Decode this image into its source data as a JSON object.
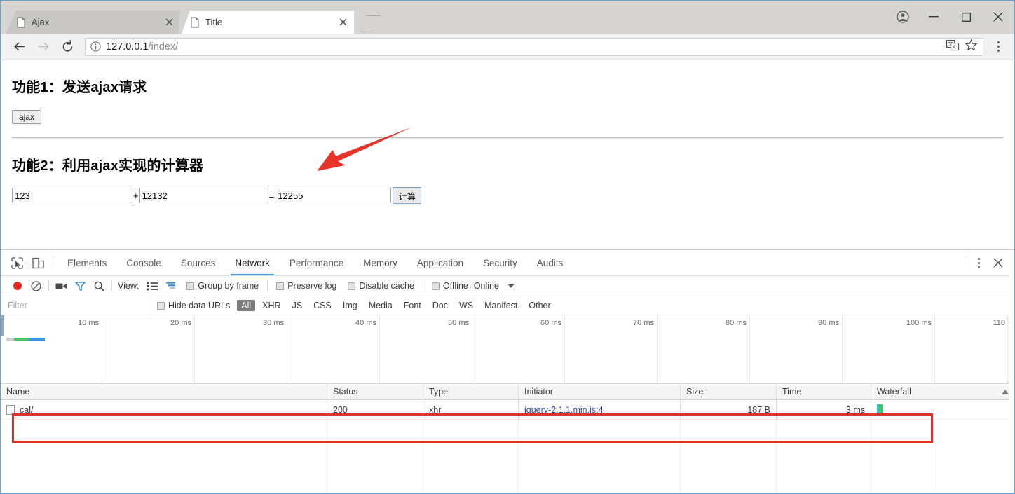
{
  "browser": {
    "tabs": [
      {
        "title": "Ajax",
        "active": false,
        "icon": "page-icon",
        "close_label": "×"
      },
      {
        "title": "Title",
        "active": true,
        "icon": "page-icon",
        "close_label": "×"
      }
    ],
    "new_tab_label": "",
    "window_controls": {
      "minimize": "—",
      "maximize": "□",
      "close": "×",
      "profile": "profile-avatar-icon"
    },
    "nav": {
      "back": "←",
      "forward": "→",
      "reload": "C"
    },
    "omnibox": {
      "security_icon": "info-circle-icon",
      "url_host": "127.0.0.1",
      "url_path": "/index/",
      "full_url": "127.0.0.1/index/",
      "translate_icon": "translate-icon",
      "bookmark_icon": "star-icon",
      "menu_icon": "three-dots-icon"
    }
  },
  "page": {
    "heading1": "功能1：发送ajax请求",
    "ajax_button": "ajax",
    "heading2": "功能2：利用ajax实现的计算器",
    "calculator": {
      "operand_a": "123",
      "operator": "+",
      "operand_b": "12132",
      "equals": "=",
      "result": "12255",
      "submit_label": "计算"
    },
    "annotation": {
      "type": "red-arrow",
      "color": "#e8332a"
    }
  },
  "devtools": {
    "left_icons": [
      "inspect-element-icon",
      "device-toolbar-icon"
    ],
    "tabs": [
      {
        "label": "Elements",
        "active": false
      },
      {
        "label": "Console",
        "active": false
      },
      {
        "label": "Sources",
        "active": false
      },
      {
        "label": "Network",
        "active": true
      },
      {
        "label": "Performance",
        "active": false
      },
      {
        "label": "Memory",
        "active": false
      },
      {
        "label": "Application",
        "active": false
      },
      {
        "label": "Security",
        "active": false
      },
      {
        "label": "Audits",
        "active": false
      }
    ],
    "right_icons": [
      "more-options-icon",
      "close-devtools-icon"
    ],
    "network_toolbar": {
      "record_icon": "record-icon",
      "clear_icon": "clear-icon",
      "capture_screenshots_icon": "camera-icon",
      "filter_icon": "filter-funnel-icon",
      "search_icon": "search-icon",
      "view_label": "View:",
      "view_list_icon": "list-view-icon",
      "view_waterfall_icon": "waterfall-view-icon",
      "group_by_frame": "Group by frame",
      "preserve_log": "Preserve log",
      "disable_cache": "Disable cache",
      "offline": "Offline",
      "throttling": "Online",
      "throttling_caret": "▼"
    },
    "filter_bar": {
      "filter_placeholder": "Filter",
      "hide_data_urls": "Hide data URLs",
      "types": [
        "All",
        "XHR",
        "JS",
        "CSS",
        "Img",
        "Media",
        "Font",
        "Doc",
        "WS",
        "Manifest",
        "Other"
      ],
      "selected_type": "All"
    },
    "overview": {
      "ticks": [
        "10 ms",
        "20 ms",
        "30 ms",
        "40 ms",
        "50 ms",
        "60 ms",
        "70 ms",
        "80 ms",
        "90 ms",
        "100 ms",
        "110"
      ]
    },
    "table": {
      "columns": [
        "Name",
        "Status",
        "Type",
        "Initiator",
        "Size",
        "Time",
        "Waterfall"
      ],
      "sort_column": "Waterfall",
      "sort_direction": "asc",
      "rows": [
        {
          "name": "cal/",
          "status": "200",
          "type": "xhr",
          "initiator": "jquery-2.1.1.min.js:4",
          "size": "187 B",
          "time": "3 ms",
          "waterfall_color": "#3ec66f"
        }
      ]
    },
    "highlight": {
      "type": "red-rectangle",
      "color": "#e03127"
    }
  }
}
